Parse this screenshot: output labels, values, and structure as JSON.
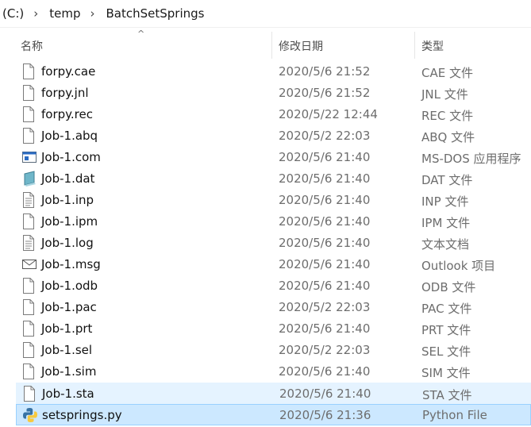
{
  "breadcrumb": [
    "(C:)",
    "temp",
    "BatchSetSprings"
  ],
  "columns": {
    "name": "名称",
    "date": "修改日期",
    "type": "类型"
  },
  "files": [
    {
      "name": "forpy.cae",
      "date": "2020/5/6 21:52",
      "type": "CAE 文件",
      "icon": "file-icon"
    },
    {
      "name": "forpy.jnl",
      "date": "2020/5/6 21:52",
      "type": "JNL 文件",
      "icon": "file-icon"
    },
    {
      "name": "forpy.rec",
      "date": "2020/5/22 12:44",
      "type": "REC 文件",
      "icon": "file-icon"
    },
    {
      "name": "Job-1.abq",
      "date": "2020/5/2 22:03",
      "type": "ABQ 文件",
      "icon": "file-icon"
    },
    {
      "name": "Job-1.com",
      "date": "2020/5/6 21:40",
      "type": "MS-DOS 应用程序",
      "icon": "msdos-icon"
    },
    {
      "name": "Job-1.dat",
      "date": "2020/5/6 21:40",
      "type": "DAT 文件",
      "icon": "dat-icon"
    },
    {
      "name": "Job-1.inp",
      "date": "2020/5/6 21:40",
      "type": "INP 文件",
      "icon": "text-file-icon"
    },
    {
      "name": "Job-1.ipm",
      "date": "2020/5/6 21:40",
      "type": "IPM 文件",
      "icon": "file-icon"
    },
    {
      "name": "Job-1.log",
      "date": "2020/5/6 21:40",
      "type": "文本文档",
      "icon": "text-file-icon"
    },
    {
      "name": "Job-1.msg",
      "date": "2020/5/6 21:40",
      "type": "Outlook 项目",
      "icon": "envelope-icon"
    },
    {
      "name": "Job-1.odb",
      "date": "2020/5/6 21:40",
      "type": "ODB 文件",
      "icon": "file-icon"
    },
    {
      "name": "Job-1.pac",
      "date": "2020/5/2 22:03",
      "type": "PAC 文件",
      "icon": "file-icon"
    },
    {
      "name": "Job-1.prt",
      "date": "2020/5/6 21:40",
      "type": "PRT 文件",
      "icon": "file-icon"
    },
    {
      "name": "Job-1.sel",
      "date": "2020/5/2 22:03",
      "type": "SEL 文件",
      "icon": "file-icon"
    },
    {
      "name": "Job-1.sim",
      "date": "2020/5/6 21:40",
      "type": "SIM 文件",
      "icon": "file-icon"
    },
    {
      "name": "Job-1.sta",
      "date": "2020/5/6 21:40",
      "type": "STA 文件",
      "icon": "file-icon",
      "state": "hover"
    },
    {
      "name": "setsprings.py",
      "date": "2020/5/6 21:36",
      "type": "Python File",
      "icon": "python-icon",
      "state": "selected"
    }
  ],
  "colors": {
    "hover": "#e5f3ff",
    "selected": "#cce8ff",
    "selected_border": "#99d1ff"
  }
}
